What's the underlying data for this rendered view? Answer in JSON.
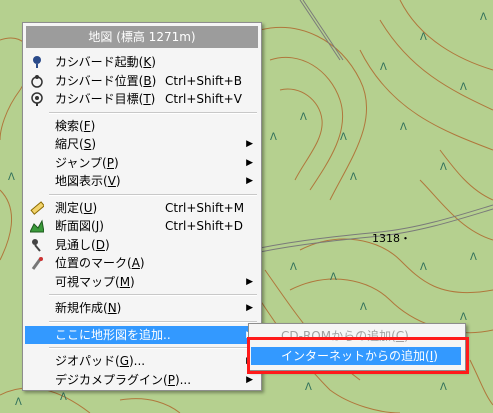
{
  "map": {
    "elevation_label": "1318・"
  },
  "context_menu": {
    "title": "地図 (標高 1271m)",
    "groups": [
      [
        {
          "label": "カシバード起動(",
          "key": "K",
          "end": ")",
          "shortcut": "",
          "icon": "kashmir-bird-icon",
          "sub": false
        },
        {
          "label": "カシバード位置(",
          "key": "B",
          "end": ")",
          "shortcut": "Ctrl+Shift+B",
          "icon": "viewpoint-position-icon",
          "sub": false
        },
        {
          "label": "カシバード目標(",
          "key": "T",
          "end": ")",
          "shortcut": "Ctrl+Shift+V",
          "icon": "viewpoint-target-icon",
          "sub": false
        }
      ],
      [
        {
          "label": "検索(",
          "key": "F",
          "end": ")",
          "shortcut": "",
          "icon": "",
          "sub": false
        },
        {
          "label": "縮尺(",
          "key": "S",
          "end": ")",
          "shortcut": "",
          "icon": "",
          "sub": true
        },
        {
          "label": "ジャンプ(",
          "key": "P",
          "end": ")",
          "shortcut": "",
          "icon": "",
          "sub": true
        },
        {
          "label": "地図表示(",
          "key": "V",
          "end": ")",
          "shortcut": "",
          "icon": "",
          "sub": true
        }
      ],
      [
        {
          "label": "測定(",
          "key": "U",
          "end": ")",
          "shortcut": "Ctrl+Shift+M",
          "icon": "ruler-icon",
          "sub": false
        },
        {
          "label": "断面図(",
          "key": "J",
          "end": ")",
          "shortcut": "Ctrl+Shift+D",
          "icon": "cross-section-icon",
          "sub": false
        },
        {
          "label": "見通し(",
          "key": "D",
          "end": ")",
          "shortcut": "",
          "icon": "line-of-sight-icon",
          "sub": false
        },
        {
          "label": "位置のマーク(",
          "key": "A",
          "end": ")",
          "shortcut": "",
          "icon": "position-mark-icon",
          "sub": false
        },
        {
          "label": "可視マップ(",
          "key": "M",
          "end": ")",
          "shortcut": "",
          "icon": "",
          "sub": true
        }
      ],
      [
        {
          "label": "新規作成(",
          "key": "N",
          "end": ")",
          "shortcut": "",
          "icon": "",
          "sub": true
        }
      ],
      [
        {
          "label": "ここに地形図を追加..",
          "key": "",
          "end": "",
          "shortcut": "",
          "icon": "",
          "sub": true,
          "highlighted": true
        }
      ],
      [
        {
          "label": "ジオパッド(",
          "key": "G",
          "end": ")...",
          "shortcut": "",
          "icon": "",
          "sub": true
        },
        {
          "label": "デジカメプラグイン(",
          "key": "P",
          "end": ")...",
          "shortcut": "",
          "icon": "",
          "sub": true
        }
      ]
    ]
  },
  "submenu": {
    "items": [
      {
        "label": "CD-ROMからの追加(",
        "key": "C",
        "end": ")",
        "disabled": true
      },
      {
        "label": "インターネットからの追加(",
        "key": "I",
        "end": ")",
        "highlighted": true
      }
    ]
  },
  "colors": {
    "map_bg": "#b5d08f",
    "contour": "#b0773c",
    "highlight": "#3399ff",
    "annotation": "#ff1a1a"
  }
}
